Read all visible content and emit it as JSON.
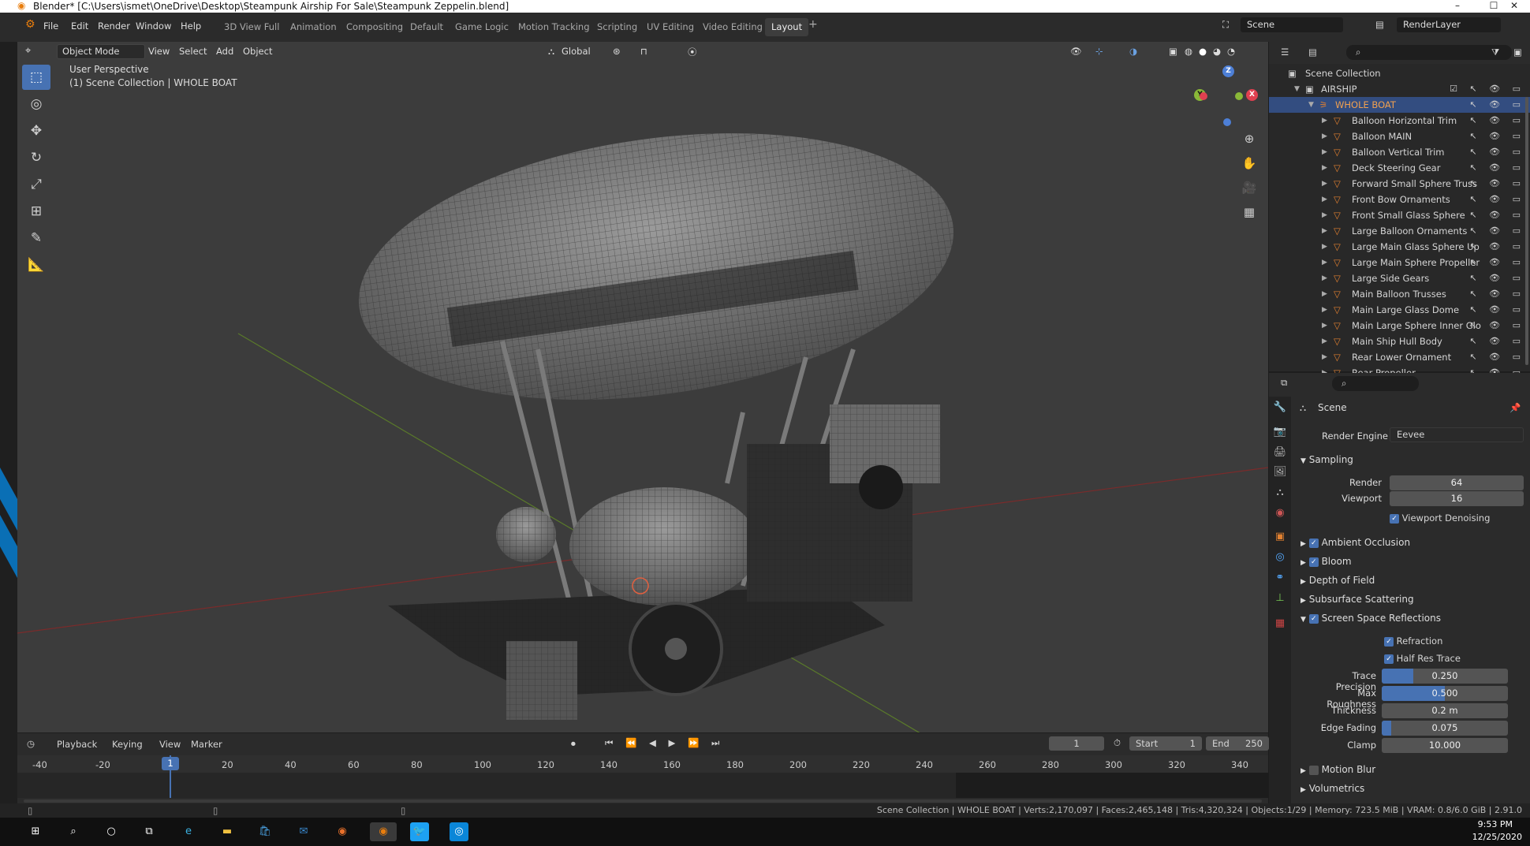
{
  "window": {
    "title": "Blender* [C:\\Users\\ismet\\OneDrive\\Desktop\\Steampunk Airship For Sale\\Steampunk Zeppelin.blend]",
    "min": "–",
    "max": "☐",
    "close": "✕"
  },
  "menu": [
    "File",
    "Edit",
    "Render",
    "Window",
    "Help"
  ],
  "workspaces": [
    "3D View Full",
    "Animation",
    "Compositing",
    "Default",
    "Game Logic",
    "Motion Tracking",
    "Scripting",
    "UV Editing",
    "Video Editing",
    "Layout"
  ],
  "active_workspace": "Layout",
  "scene_field": "Scene",
  "layer_field": "RenderLayer",
  "viewport": {
    "mode": "Object Mode",
    "menus": [
      "View",
      "Select",
      "Add",
      "Object"
    ],
    "transform": "Global",
    "overlay_title": "User Perspective",
    "overlay_sub": "(1) Scene Collection | WHOLE BOAT",
    "gizmo": {
      "z": "Z",
      "y": "Y",
      "x": "X"
    }
  },
  "tools": [
    "select-box-icon",
    "cursor-icon",
    "move-icon",
    "rotate-icon",
    "scale-icon",
    "transform-icon",
    "annotate-icon",
    "measure-icon"
  ],
  "outliner": {
    "scene_collection": "Scene Collection",
    "collection": "AIRSHIP",
    "selected": "WHOLE BOAT",
    "items": [
      "Balloon Horizontal Trim",
      "Balloon MAIN",
      "Balloon Vertical Trim",
      "Deck Steering Gear",
      "Forward Small Sphere Truss",
      "Front Bow Ornaments",
      "Front Small Glass Sphere",
      "Large Balloon Ornaments",
      "Large Main Glass Sphere Up",
      "Large Main Sphere Propeller",
      "Large Side Gears",
      "Main Balloon Trusses",
      "Main Large Glass Dome",
      "Main Large Sphere Inner Glo",
      "Main Ship Hull Body",
      "Rear Lower Ornament",
      "Rear Propeller"
    ]
  },
  "properties": {
    "context": "Scene",
    "render_engine_label": "Render Engine",
    "render_engine": "Eevee",
    "sampling": "Sampling",
    "render_label": "Render",
    "render_value": "64",
    "viewport_label": "Viewport",
    "viewport_value": "16",
    "viewport_denoising": "Viewport Denoising",
    "sections": [
      "Ambient Occlusion",
      "Bloom",
      "Depth of Field",
      "Subsurface Scattering",
      "Screen Space Reflections"
    ],
    "refraction": "Refraction",
    "half_res": "Half Res Trace",
    "fields": [
      {
        "label": "Trace Precision",
        "value": "0.250",
        "fill": 0.25
      },
      {
        "label": "Max Roughness",
        "value": "0.500",
        "fill": 0.5
      },
      {
        "label": "Thickness",
        "value": "0.2 m",
        "fill": 0
      },
      {
        "label": "Edge Fading",
        "value": "0.075",
        "fill": 0.075
      },
      {
        "label": "Clamp",
        "value": "10.000",
        "fill": 0
      }
    ],
    "motion_blur": "Motion Blur",
    "volumetrics": "Volumetrics"
  },
  "timeline": {
    "menus": [
      "Playback",
      "Keying",
      "View",
      "Marker"
    ],
    "current_frame": "1",
    "start_label": "Start",
    "start": "1",
    "end_label": "End",
    "end": "250",
    "ticks": [
      "-40",
      "-20",
      "1",
      "20",
      "40",
      "60",
      "80",
      "100",
      "120",
      "140",
      "160",
      "180",
      "200",
      "220",
      "240",
      "260",
      "280",
      "300",
      "320",
      "340"
    ]
  },
  "status": "Scene Collection | WHOLE BOAT | Verts:2,170,097 | Faces:2,465,148 | Tris:4,320,324 | Objects:1/29 | Memory: 723.5 MiB | VRAM: 0.8/6.0 GiB | 2.91.0",
  "taskbar": {
    "time": "9:53 PM",
    "date": "12/25/2020"
  }
}
